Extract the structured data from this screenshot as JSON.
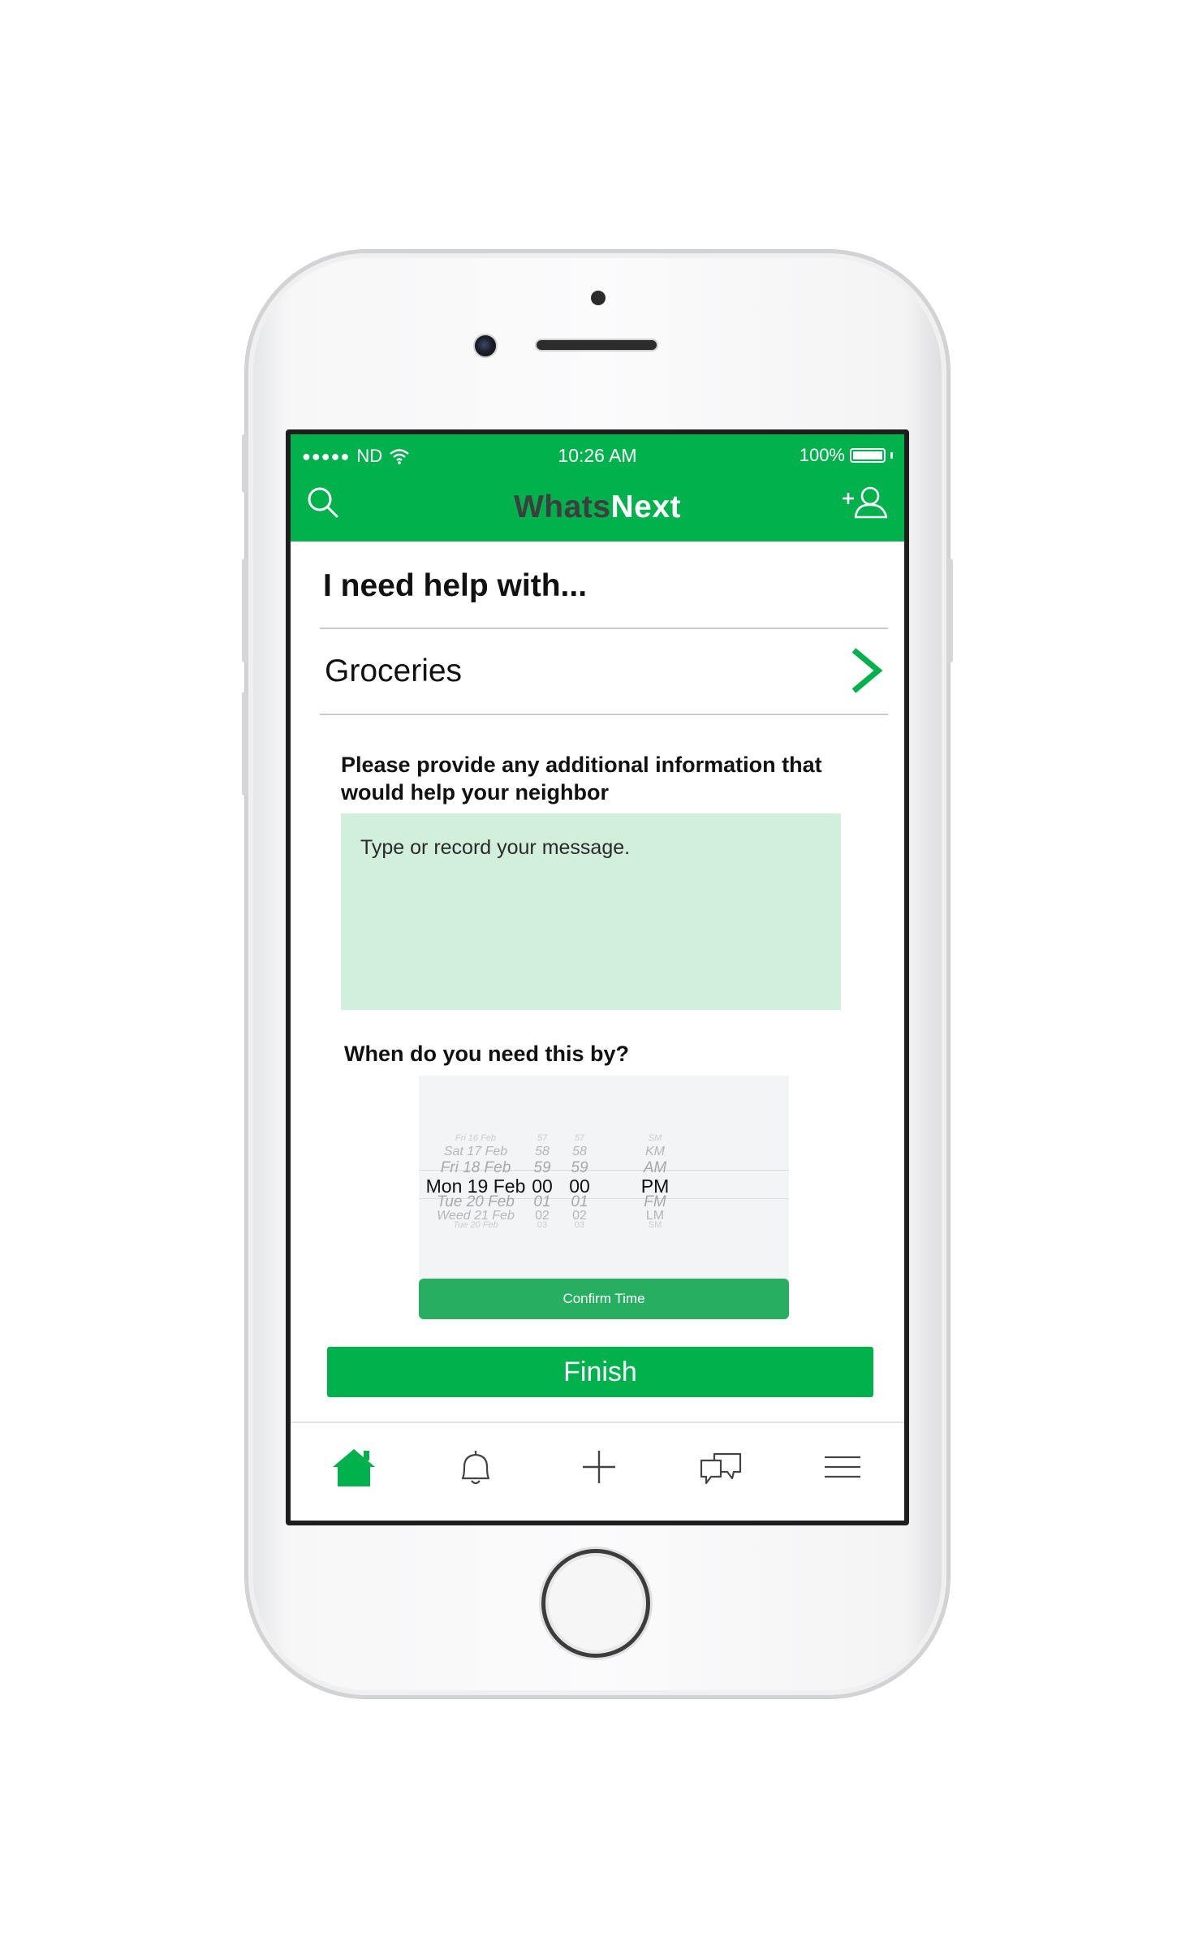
{
  "status_bar": {
    "signal_dots": "●●●●●",
    "carrier": "ND",
    "wifi_icon": "wifi-icon",
    "time": "10:26 AM",
    "battery": "100%"
  },
  "nav": {
    "brand_part1": "Whats",
    "brand_part2": "Next",
    "search_icon": "search-icon",
    "add_user_icon": "add-user-icon"
  },
  "form": {
    "heading": "I need help with...",
    "category": "Groceries",
    "info_label": "Please provide any additional information that would help your neighbor",
    "message_placeholder": "Type or record your message.",
    "message_value": "",
    "when_label": "When do you need this by?",
    "confirm_label": "Confirm Time",
    "finish_label": "Finish"
  },
  "picker": {
    "dates": [
      "Fri 16 Feb",
      "Sat 17 Feb",
      "Fri 18 Feb",
      "Mon 19 Feb",
      "Tue 20 Feb",
      "Weed 21 Feb",
      "Tue 20 Feb"
    ],
    "hours": [
      "57",
      "58",
      "59",
      "00",
      "01",
      "02",
      "03"
    ],
    "minutes": [
      "57",
      "58",
      "59",
      "00",
      "01",
      "02",
      "03"
    ],
    "ampm": [
      "SM",
      "KM",
      "AM",
      "PM",
      "FM",
      "LM",
      "SM"
    ],
    "selected_index": 3
  },
  "tabs": [
    {
      "name": "tab-home",
      "icon": "home-icon",
      "active": true
    },
    {
      "name": "tab-notifications",
      "icon": "bell-icon",
      "active": false
    },
    {
      "name": "tab-new",
      "icon": "plus-icon",
      "active": false
    },
    {
      "name": "tab-messages",
      "icon": "chat-icon",
      "active": false
    },
    {
      "name": "tab-menu",
      "icon": "menu-icon",
      "active": false
    }
  ],
  "colors": {
    "brand_green": "#00b14c",
    "confirm_green": "#27ae60",
    "message_bg": "#d2efdc",
    "brand_dark": "#3e3e3e"
  }
}
